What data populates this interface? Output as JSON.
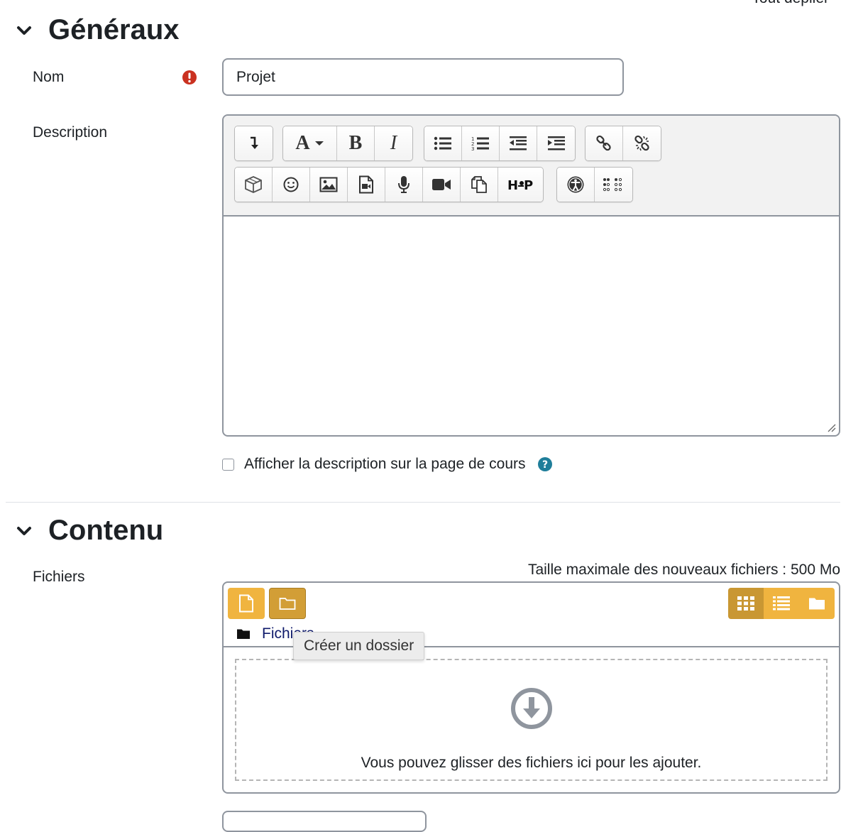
{
  "top_link": "Tout déplier",
  "sections": {
    "general": {
      "title": "Généraux"
    },
    "content": {
      "title": "Contenu"
    }
  },
  "fields": {
    "name": {
      "label": "Nom",
      "value": "Projet"
    },
    "description": {
      "label": "Description"
    },
    "show_description": {
      "label": "Afficher la description sur la page de cours",
      "checked": false
    },
    "files": {
      "label": "Fichiers"
    }
  },
  "editor": {
    "toolbar_row1": [
      "show-more-buttons",
      "font-style",
      "bold",
      "italic",
      "unordered-list",
      "ordered-list",
      "outdent",
      "indent",
      "link",
      "unlink"
    ],
    "toolbar_row2": [
      "media-library",
      "emoji",
      "image",
      "media",
      "record-audio",
      "record-video",
      "manage-files",
      "h5p",
      "accessibility-checker",
      "screenreader-helper"
    ],
    "bold_glyph": "B",
    "italic_glyph": "I",
    "font_glyph": "A"
  },
  "filemanager": {
    "max_size": "Taille maximale des nouveaux fichiers : 500 Mo",
    "path_root": "Fichiers",
    "tooltip": "Créer un dossier",
    "dropzone_message": "Vous pouvez glisser des fichiers ici pour les ajouter.",
    "views": [
      "icons",
      "list",
      "tree"
    ],
    "active_view": "icons"
  },
  "colors": {
    "accent": "#f0b43f",
    "accent_dark": "#c99733",
    "required": "#ca3120",
    "help": "#1f7e9a"
  }
}
